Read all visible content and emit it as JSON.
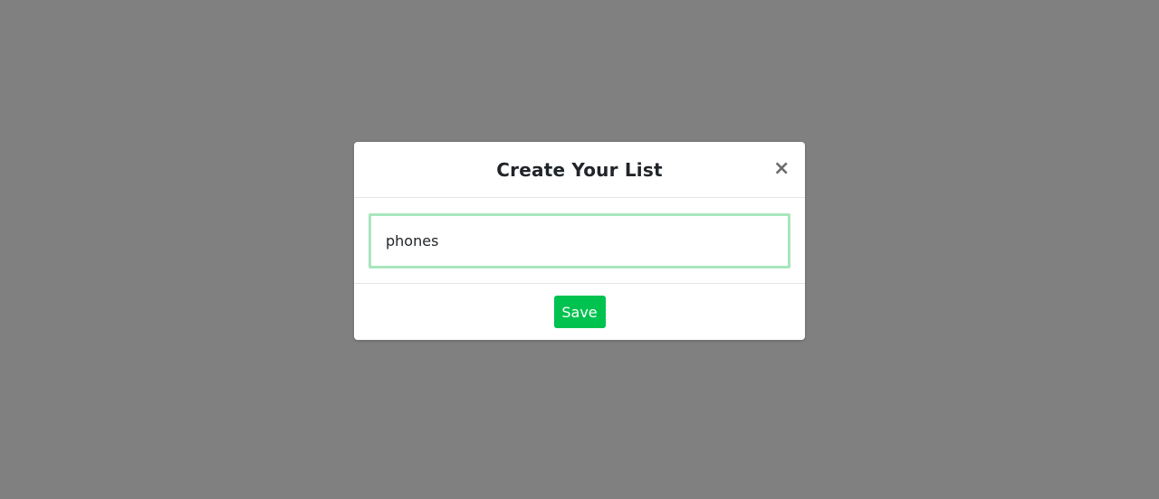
{
  "modal": {
    "title": "Create Your List",
    "close_glyph": "×",
    "close_icon": "close-icon",
    "input": {
      "value": "phones",
      "border_color": "#a8e6bd"
    },
    "save_label": "Save"
  },
  "colors": {
    "backdrop": "#808080",
    "save_button": "#00c24f",
    "title_text": "#212529"
  }
}
